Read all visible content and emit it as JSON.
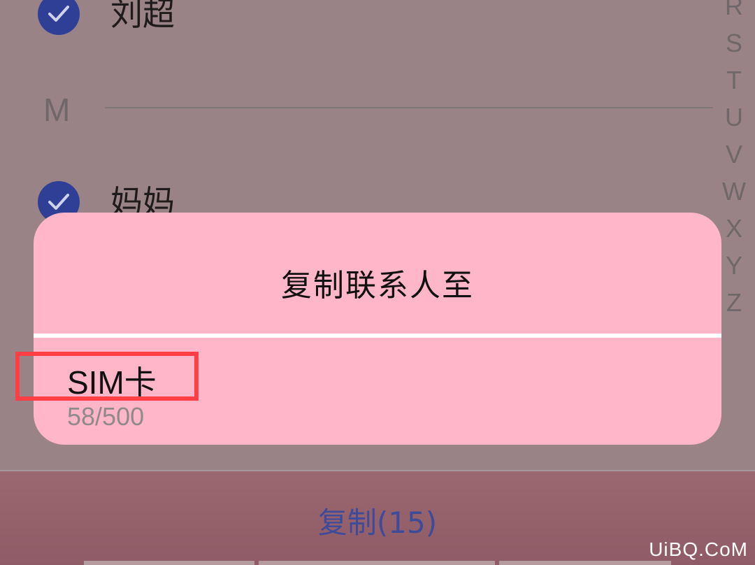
{
  "contacts": [
    {
      "name": "刘超",
      "checked": true
    },
    {
      "name": "妈妈",
      "checked": true
    }
  ],
  "section_letter": "M",
  "alpha_index": [
    "R",
    "S",
    "T",
    "U",
    "V",
    "W",
    "X",
    "Y",
    "Z"
  ],
  "dialog": {
    "title": "复制联系人至",
    "option_label": "SIM卡",
    "option_count": "58/500"
  },
  "bottom_bar": {
    "copy_label": "复制(15)"
  },
  "watermark": "UiBQ.CoM",
  "colors": {
    "dialog_bg": "#ffb6c8",
    "check_blue": "#2f3f96",
    "highlight_red": "#ff3f45",
    "copy_text": "#3e4a9a"
  }
}
